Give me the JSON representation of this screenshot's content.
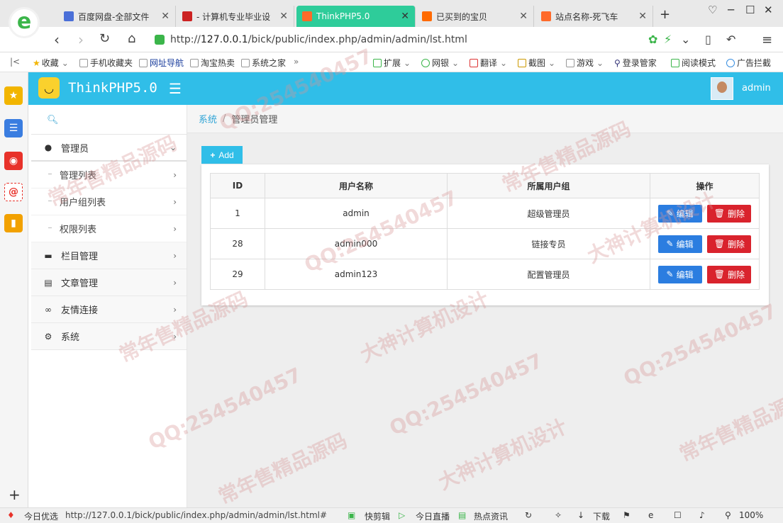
{
  "browser": {
    "tabs": [
      {
        "label": "百度网盘-全部文件",
        "favicon_color": "#4a6fd8"
      },
      {
        "label": "- 计算机专业毕业设",
        "favicon_color": "#cc2222"
      },
      {
        "label": "ThinkPHP5.0",
        "favicon_color": "#ff6a2a",
        "active": true
      },
      {
        "label": "已买到的宝贝",
        "favicon_color": "#ff6a00"
      },
      {
        "label": "站点名称-死飞车",
        "favicon_color": "#ff6a2a"
      }
    ],
    "new_tab": "+",
    "url_host": "127.0.0.1",
    "url_scheme": "http://",
    "url_path": "/bick/public/index.php/admin/admin/lst.html",
    "bookmarks": [
      "收藏",
      "手机收藏夹",
      "网址导航",
      "淘宝热卖",
      "系统之家",
      "扩展",
      "网银",
      "翻译",
      "截图",
      "游戏",
      "登录管家",
      "阅读模式",
      "广告拦截"
    ]
  },
  "app": {
    "brand": "ThinkPHP5.0",
    "user": "admin"
  },
  "sidebar": {
    "items": [
      {
        "label": "管理员",
        "icon": "user-icon",
        "open": true
      },
      {
        "label": "栏目管理",
        "icon": "folder-icon"
      },
      {
        "label": "文章管理",
        "icon": "file-icon"
      },
      {
        "label": "友情连接",
        "icon": "link-icon"
      },
      {
        "label": "系统",
        "icon": "gear-icon"
      }
    ],
    "subitems": [
      "管理列表",
      "用户组列表",
      "权限列表"
    ]
  },
  "breadcrumb": {
    "root": "系统",
    "sep": "/",
    "current": "管理员管理"
  },
  "toolbar": {
    "add_label": "Add"
  },
  "table": {
    "headers": [
      "ID",
      "用户名称",
      "所属用户组",
      "操作"
    ],
    "rows": [
      {
        "id": "1",
        "name": "admin",
        "group": "超级管理员"
      },
      {
        "id": "28",
        "name": "admin000",
        "group": "链接专员"
      },
      {
        "id": "29",
        "name": "admin123",
        "group": "配置管理员"
      }
    ],
    "edit_label": "编辑",
    "delete_label": "删除"
  },
  "statusbar": {
    "left_label": "今日优选",
    "url": "http://127.0.0.1/bick/public/index.php/admin/admin/lst.html#",
    "items": [
      "快剪辑",
      "今日直播",
      "热点资讯",
      "下载"
    ],
    "zoom": "100%"
  },
  "watermarks": [
    "QQ:254540457",
    "常年售精品源码",
    "大神计算机设计"
  ]
}
